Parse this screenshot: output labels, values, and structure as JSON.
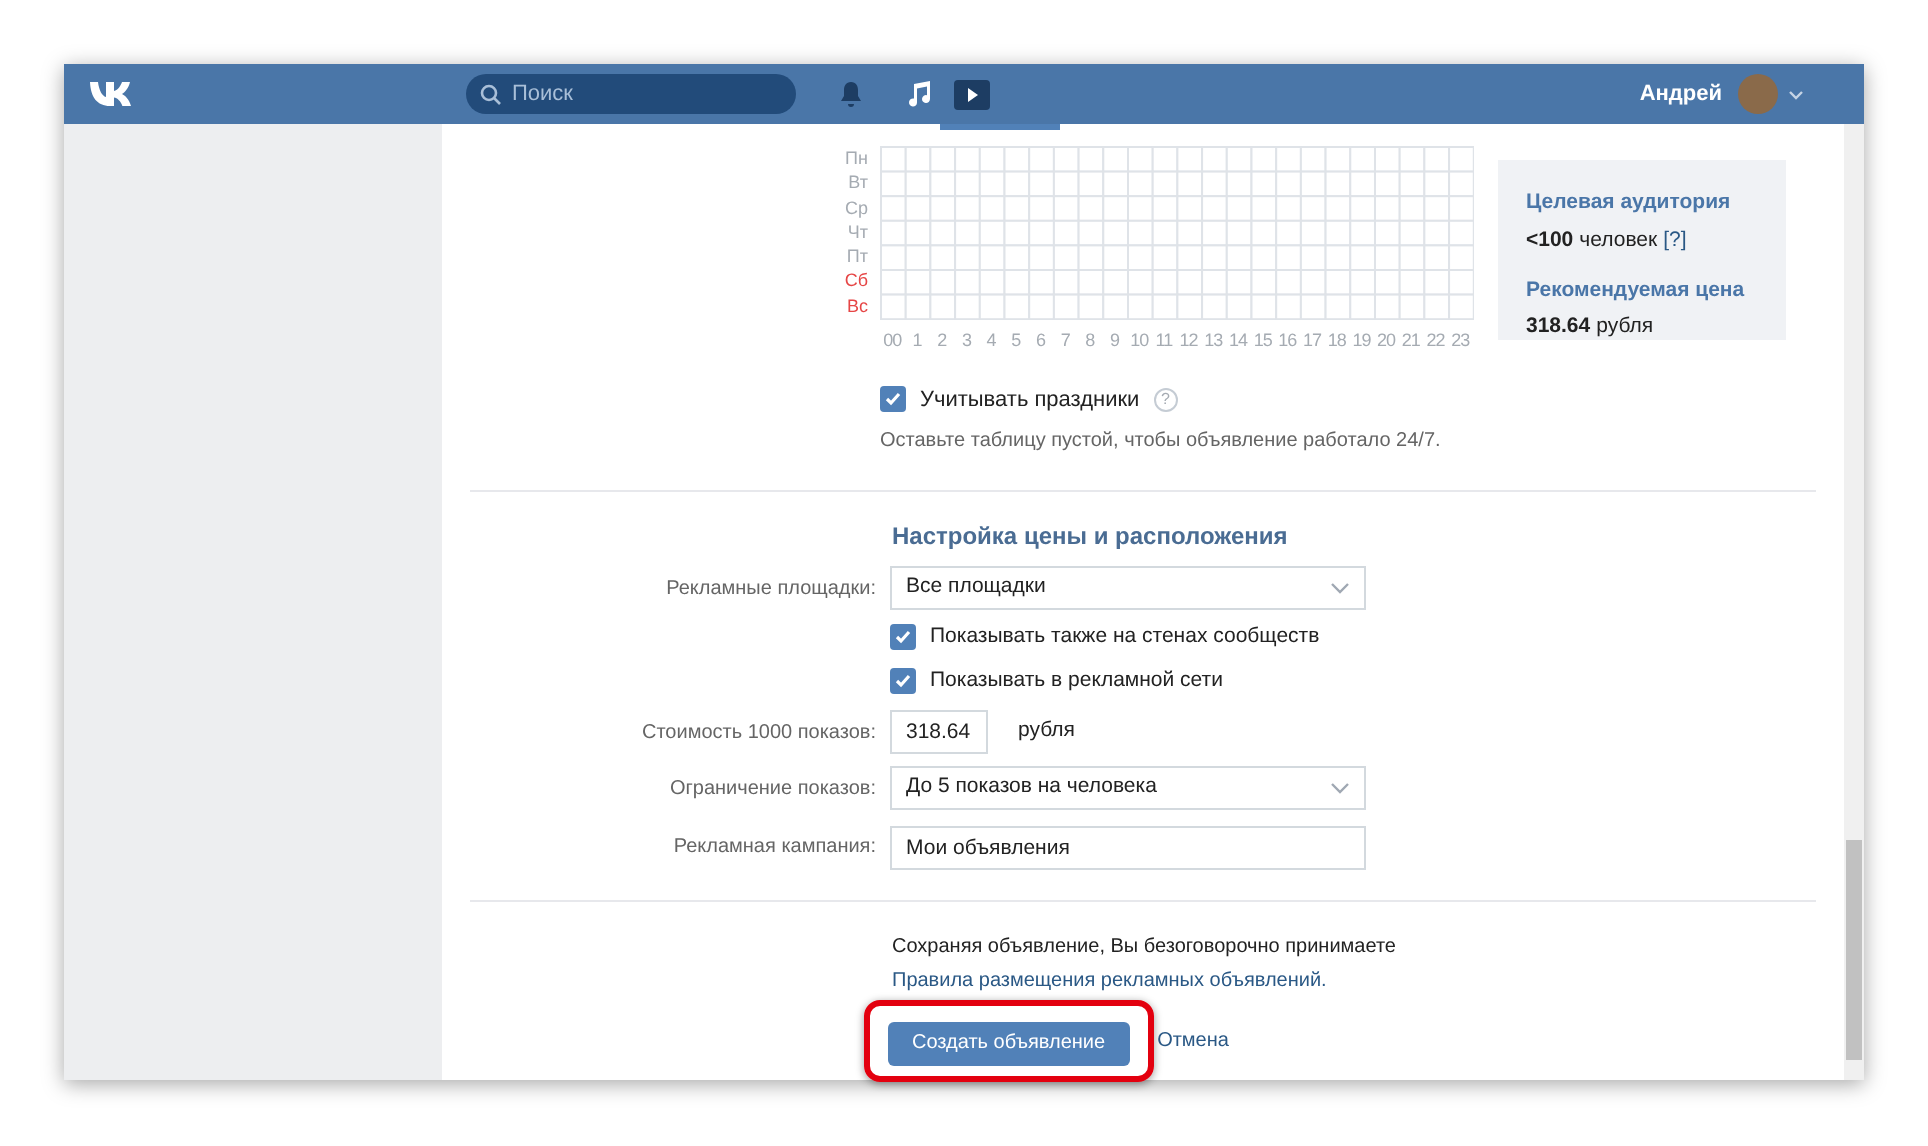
{
  "header": {
    "search": {
      "placeholder": "Поиск"
    },
    "user_name": "Андрей"
  },
  "schedule": {
    "days": [
      {
        "label": "Пн",
        "weekend": false
      },
      {
        "label": "Вт",
        "weekend": false
      },
      {
        "label": "Ср",
        "weekend": false
      },
      {
        "label": "Чт",
        "weekend": false
      },
      {
        "label": "Пт",
        "weekend": false
      },
      {
        "label": "Сб",
        "weekend": true
      },
      {
        "label": "Вс",
        "weekend": true
      }
    ],
    "hours": [
      "00",
      "1",
      "2",
      "3",
      "4",
      "5",
      "6",
      "7",
      "8",
      "9",
      "10",
      "11",
      "12",
      "13",
      "14",
      "15",
      "16",
      "17",
      "18",
      "19",
      "20",
      "21",
      "22",
      "23"
    ],
    "holidays": {
      "label": "Учитывать праздники",
      "checked": true,
      "help": "?"
    },
    "hint": "Оставьте таблицу пустой, чтобы объявление работало 24/7."
  },
  "summary": [
    {
      "title": "Целевая аудитория",
      "value": "<100",
      "unit": "человек",
      "help": "[?]"
    },
    {
      "title": "Рекомендуемая цена",
      "value": "318.64",
      "unit": "рубля"
    }
  ],
  "pricing": {
    "title": "Настройка цены и расположения",
    "fields": [
      {
        "kind": "select",
        "label": "Рекламные площадки:",
        "value": "Все площадки"
      },
      {
        "kind": "checkbox",
        "label": "Показывать также на стенах сообществ",
        "checked": true
      },
      {
        "kind": "checkbox",
        "label": "Показывать в рекламной сети",
        "checked": true
      },
      {
        "kind": "input",
        "label": "Стоимость 1000 показов:",
        "value": "318.64",
        "unit": "рубля"
      },
      {
        "kind": "select",
        "label": "Ограничение показов:",
        "value": "До 5 показов на человека"
      },
      {
        "kind": "text",
        "label": "Рекламная кампания:",
        "value": "Мои объявления"
      }
    ]
  },
  "footer": {
    "notice": "Сохраняя объявление, Вы безоговорочно принимаете",
    "rules_link": "Правила размещения рекламных объявлений.",
    "submit": "Создать объявление",
    "cancel": "Отмена"
  }
}
